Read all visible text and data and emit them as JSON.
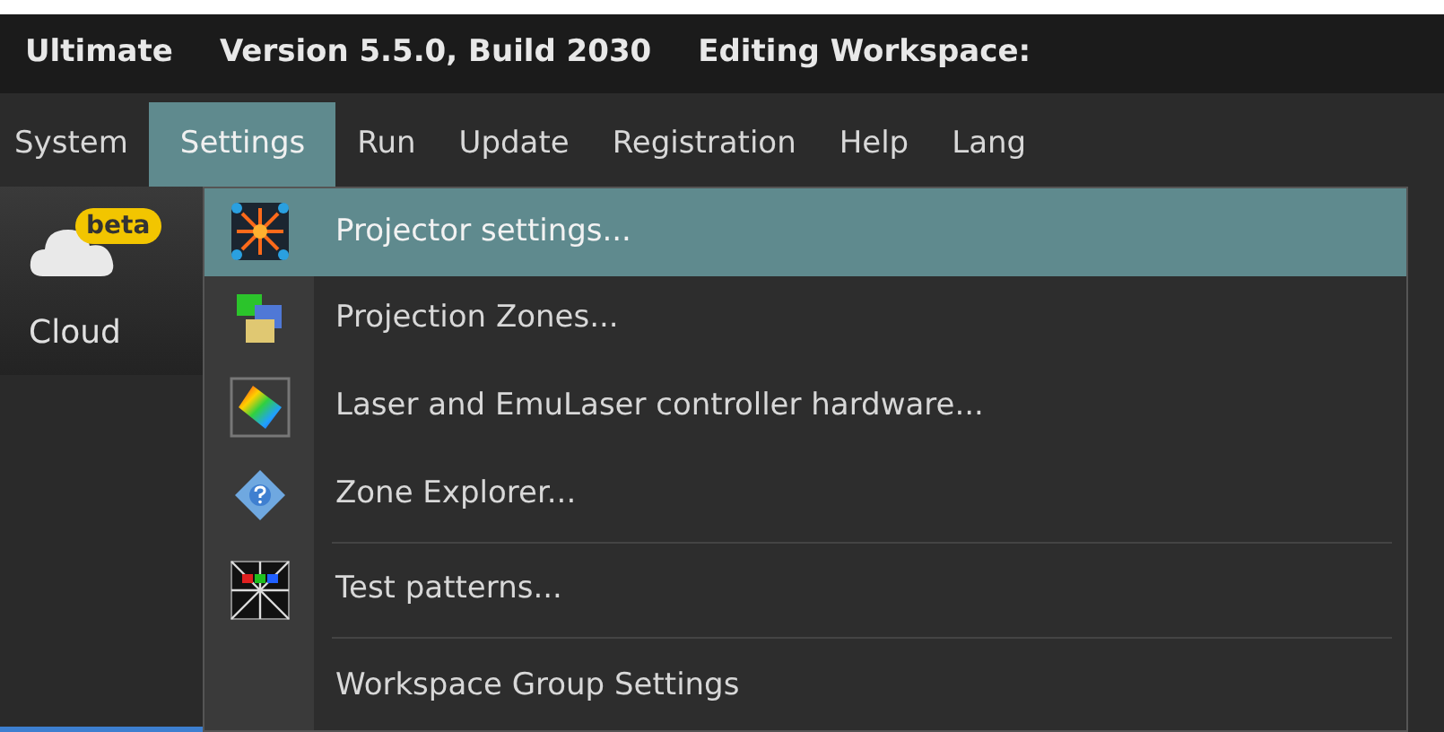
{
  "title_bar": {
    "app": "Ultimate",
    "version": "Version 5.5.0, Build 2030",
    "workspace": "Editing Workspace:"
  },
  "menu_bar": [
    {
      "label": "System",
      "selected": false
    },
    {
      "label": "Settings",
      "selected": true
    },
    {
      "label": "Run",
      "selected": false
    },
    {
      "label": "Update",
      "selected": false
    },
    {
      "label": "Registration",
      "selected": false
    },
    {
      "label": "Help",
      "selected": false
    },
    {
      "label": "Lang",
      "selected": false
    }
  ],
  "toolbar": {
    "cloud_button": {
      "label": "Cloud",
      "badge": "beta"
    }
  },
  "settings_menu": [
    {
      "kind": "item",
      "label": "Projector settings...",
      "selected": true
    },
    {
      "kind": "item",
      "label": "Projection Zones...",
      "selected": false
    },
    {
      "kind": "item",
      "label": "Laser and EmuLaser controller hardware...",
      "selected": false
    },
    {
      "kind": "item",
      "label": "Zone Explorer...",
      "selected": false
    },
    {
      "kind": "separator"
    },
    {
      "kind": "item",
      "label": "Test patterns...",
      "selected": false
    },
    {
      "kind": "separator"
    },
    {
      "kind": "item",
      "label": "Workspace Group Settings",
      "selected": false
    }
  ]
}
